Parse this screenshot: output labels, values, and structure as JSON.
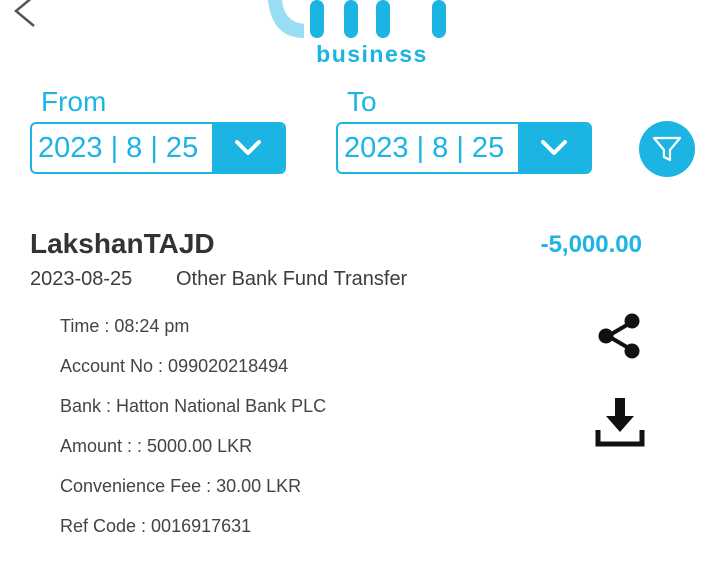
{
  "header": {
    "back_icon": "chevron-left-icon",
    "logo_text": "business"
  },
  "date_range": {
    "from_label": "From",
    "from_value": "2023 | 8 | 25",
    "to_label": "To",
    "to_value": "2023 | 8 | 25",
    "dropdown_icon": "chevron-down-icon",
    "filter_icon": "filter-icon"
  },
  "transaction": {
    "payee": "LakshanTAJD",
    "amount": "-5,000.00",
    "date": "2023-08-25",
    "type": "Other Bank Fund Transfer",
    "details": {
      "time": "Time  : 08:24 pm",
      "account": "Account No  : 099020218494",
      "bank": "Bank  : Hatton National Bank PLC",
      "amount": "Amount : : 5000.00 LKR",
      "fee": "Convenience Fee : 30.00 LKR",
      "ref": "Ref Code : 0016917631"
    },
    "share_icon": "share-icon",
    "download_icon": "download-icon"
  },
  "colors": {
    "accent": "#1cb4e2",
    "text": "#3d3d3d",
    "background": "#ffffff"
  }
}
